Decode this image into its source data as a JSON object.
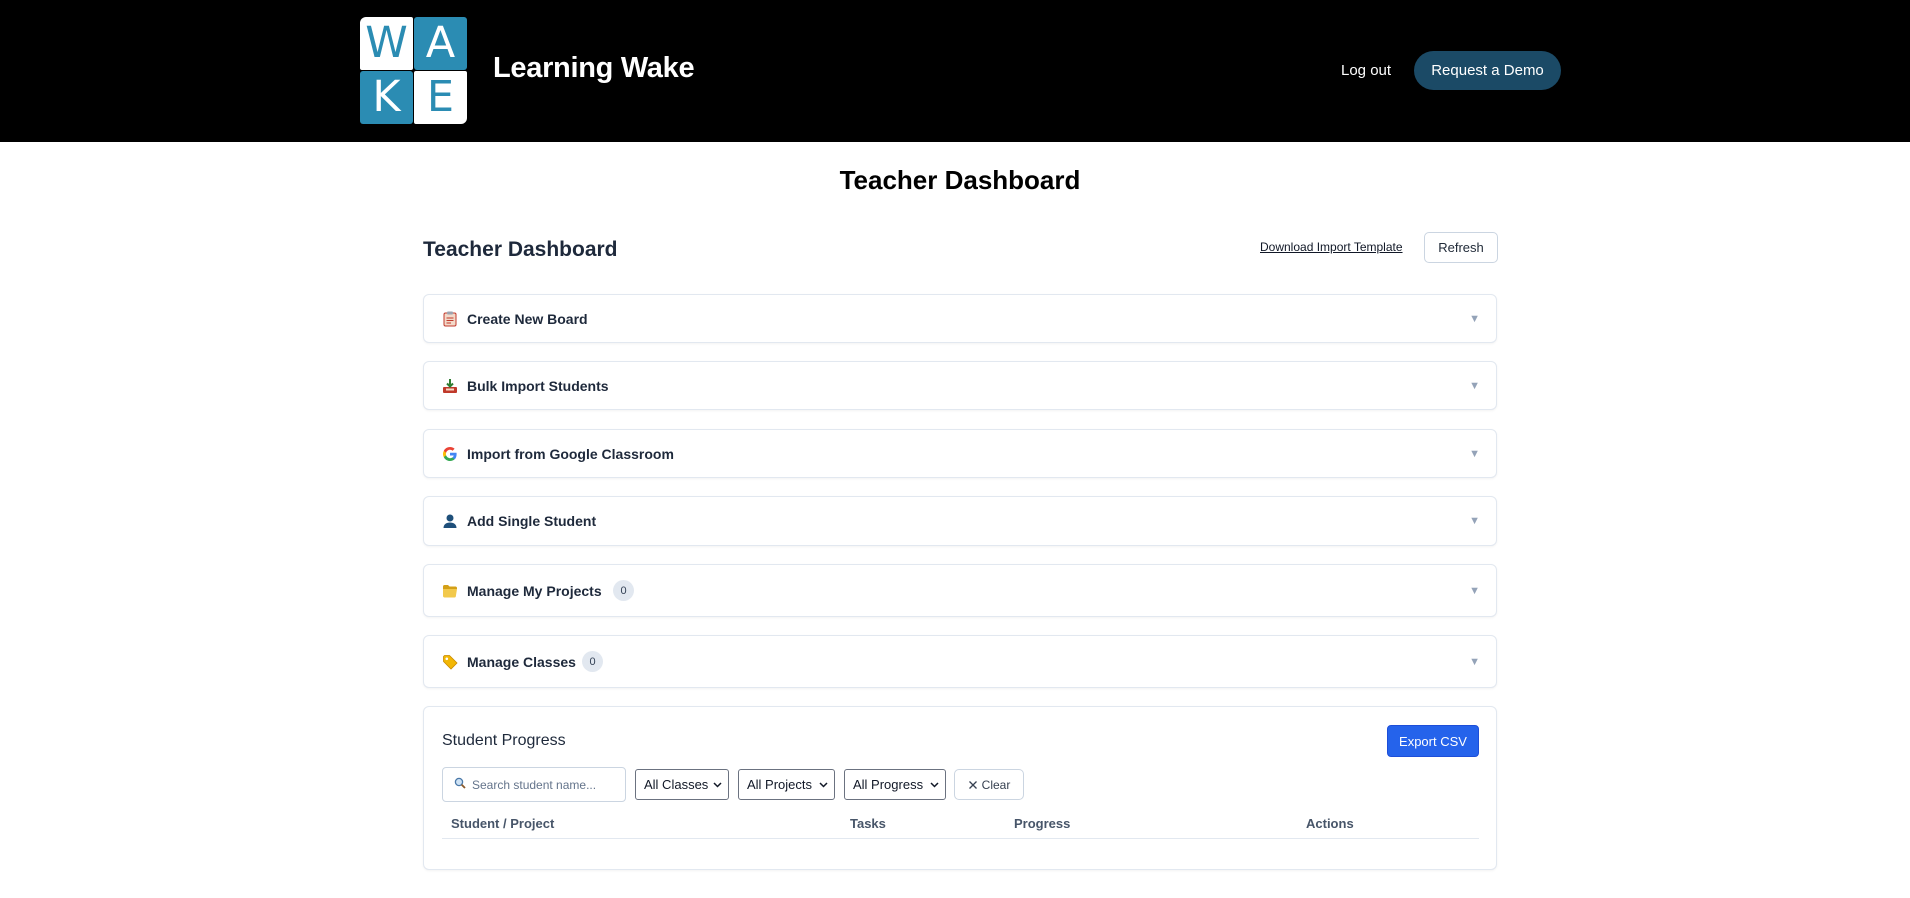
{
  "header": {
    "logo_letters": [
      "W",
      "A",
      "K",
      "E"
    ],
    "brand": "Learning Wake",
    "logout_label": "Log out",
    "demo_label": "Request a Demo",
    "background_color": "#000000",
    "logo_color": "#2b8cb3",
    "demo_button_color": "#1b4a66"
  },
  "page": {
    "title": "Teacher Dashboard"
  },
  "dashboard": {
    "heading": "Teacher Dashboard",
    "download_template_label": "Download Import Template",
    "refresh_label": "Refresh"
  },
  "accordions": [
    {
      "icon": "clipboard-icon",
      "label": "Create New Board"
    },
    {
      "icon": "inbox-tray-icon",
      "label": "Bulk Import Students"
    },
    {
      "icon": "google-icon",
      "label": "Import from Google Classroom"
    },
    {
      "icon": "person-icon",
      "label": "Add Single Student"
    },
    {
      "icon": "folder-icon",
      "label": "Manage My Projects",
      "count": "0"
    },
    {
      "icon": "tag-icon",
      "label": "Manage Classes",
      "count": "0"
    }
  ],
  "student_progress": {
    "title": "Student Progress",
    "export_label": "Export CSV",
    "export_color": "#2563eb",
    "search_placeholder": "Search student name...",
    "class_filter": "All Classes",
    "project_filter": "All Projects",
    "progress_filter": "All Progress",
    "clear_label": "Clear",
    "columns": [
      "Student / Project",
      "Tasks",
      "Progress",
      "Actions"
    ]
  }
}
